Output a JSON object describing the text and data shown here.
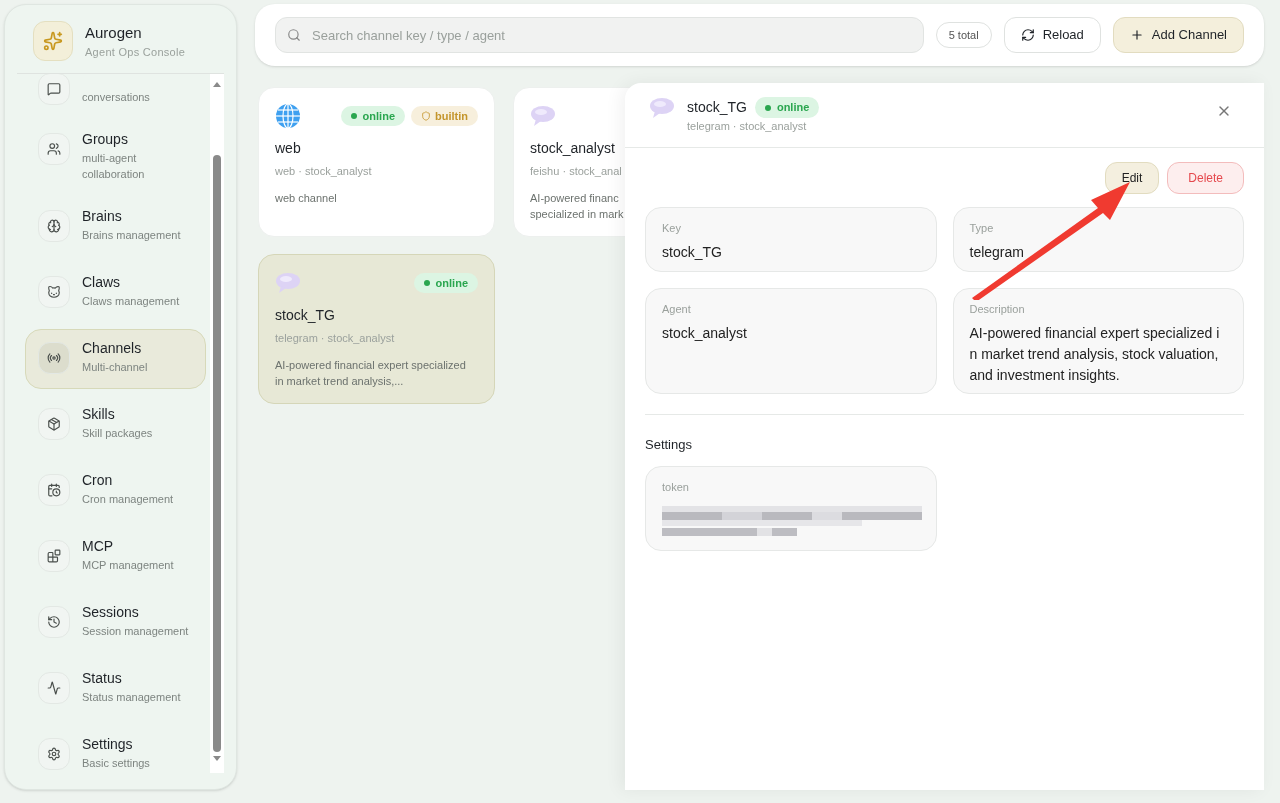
{
  "brand": {
    "name": "Aurogen",
    "subtitle": "Agent Ops Console"
  },
  "sidebar": {
    "items": [
      {
        "kind": "partial",
        "subtitle": "conversations",
        "selected": false
      },
      {
        "kind": "full",
        "title": "Groups",
        "subtitle": "multi-agent collaboration",
        "selected": false
      },
      {
        "kind": "full",
        "title": "Brains",
        "subtitle": "Brains management",
        "selected": false
      },
      {
        "kind": "full",
        "title": "Claws",
        "subtitle": "Claws management",
        "selected": false
      },
      {
        "kind": "full",
        "title": "Channels",
        "subtitle": "Multi-channel",
        "selected": true
      },
      {
        "kind": "full",
        "title": "Skills",
        "subtitle": "Skill packages",
        "selected": false
      },
      {
        "kind": "full",
        "title": "Cron",
        "subtitle": "Cron management",
        "selected": false
      },
      {
        "kind": "full",
        "title": "MCP",
        "subtitle": "MCP management",
        "selected": false
      },
      {
        "kind": "full",
        "title": "Sessions",
        "subtitle": "Session management",
        "selected": false
      },
      {
        "kind": "full",
        "title": "Status",
        "subtitle": "Status management",
        "selected": false
      },
      {
        "kind": "full",
        "title": "Settings",
        "subtitle": "Basic settings",
        "selected": false
      }
    ]
  },
  "toolbar": {
    "search": {
      "placeholder": "Search channel key / type / agent"
    },
    "count": "5 total",
    "buttons": [
      "Reload",
      "Add Channel"
    ]
  },
  "cards": [
    {
      "kind": "web",
      "title": "web",
      "meta": "web · stock_analyst",
      "description": "web channel",
      "status": "online",
      "builtin": "builtin",
      "selected": false
    },
    {
      "kind": "chat",
      "title": "stock_analyst",
      "meta": "feishu · stock_anal",
      "description": "AI-powered financ\nspecialized in mark",
      "selected": false
    },
    {
      "kind": "chat",
      "title": "stock_TG",
      "meta": "telegram · stock_analyst",
      "description": "AI-powered financial expert specialized in market trend analysis,...",
      "status": "online",
      "selected": true
    }
  ],
  "drawer": {
    "title": "stock_TG",
    "status": "online",
    "meta": "telegram · stock_analyst",
    "actions": [
      "Edit",
      "Delete"
    ],
    "fields": [
      {
        "label": "Key",
        "value": "stock_TG"
      },
      {
        "label": "Type",
        "value": "telegram"
      },
      {
        "label": "Agent",
        "value": "stock_analyst"
      },
      {
        "label": "Description",
        "value": "AI-powered financial expert specialized in market trend analysis, stock valuation, and investment insights."
      }
    ],
    "settings": {
      "heading": "Settings",
      "fields": [
        {
          "label": "token"
        }
      ]
    }
  }
}
